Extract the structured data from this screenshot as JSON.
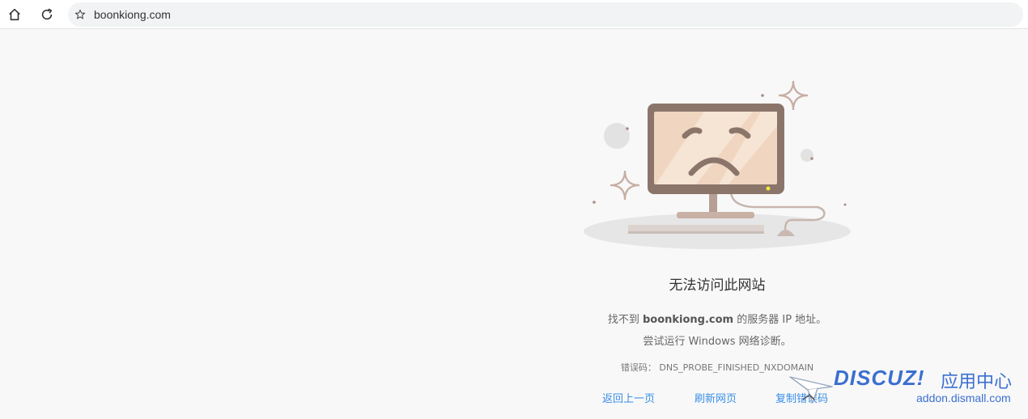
{
  "browser": {
    "url": "boonkiong.com",
    "icons": {
      "home": "home-icon",
      "reload": "reload-icon",
      "bookmark": "star-icon"
    }
  },
  "error": {
    "title": "无法访问此网站",
    "line1_prefix": "找不到 ",
    "line1_domain": "boonkiong.com",
    "line1_suffix": " 的服务器 IP 地址。",
    "line2": "尝试运行 Windows 网络诊断。",
    "code_label": "错误码：",
    "code_value": "DNS_PROBE_FINISHED_NXDOMAIN",
    "links": {
      "back": "返回上一页",
      "refresh": "刷新网页",
      "copy": "复制错误码"
    }
  },
  "watermark": {
    "brand": "DISCUZ!",
    "cn": "应用中心",
    "url": "addon.dismall.com"
  },
  "colors": {
    "link": "#3a8ee6",
    "watermark": "#3b6fd0",
    "monitor_frame": "#8b756b",
    "screen": "#f0d6c0"
  }
}
